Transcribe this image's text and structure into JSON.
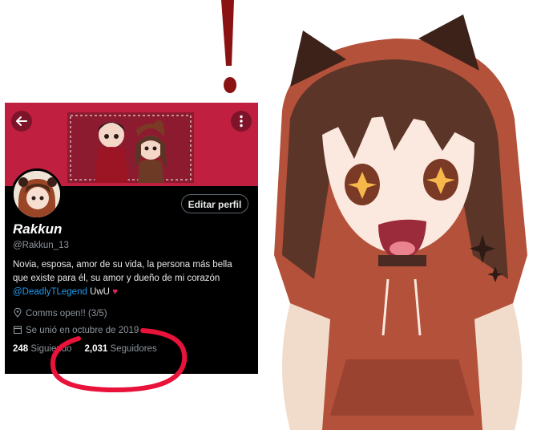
{
  "header": {
    "back_icon": "arrow-left-icon",
    "more_icon": "kebab-menu-icon"
  },
  "profile": {
    "name": "Rakkun",
    "handle": "@Rakkun_13",
    "edit_button": "Editar perfil",
    "bio_line1": "Novia, esposa, amor de su vida, la persona más bella",
    "bio_line2": "que existe para él, su amor y dueño de mi corazón",
    "mention": "@DeadlyTLegend",
    "bio_suffix": " UwU ",
    "heart": "♥",
    "location": "Comms open!! (3/5)",
    "joined": "Se unió en octubre de 2019",
    "following_count": "248",
    "following_label": "Siguiendo",
    "followers_count": "2,031",
    "followers_label": "Seguidores"
  },
  "colors": {
    "banner": "#c11f3f",
    "link": "#1d9bf0",
    "annotation": "#e8123a"
  }
}
